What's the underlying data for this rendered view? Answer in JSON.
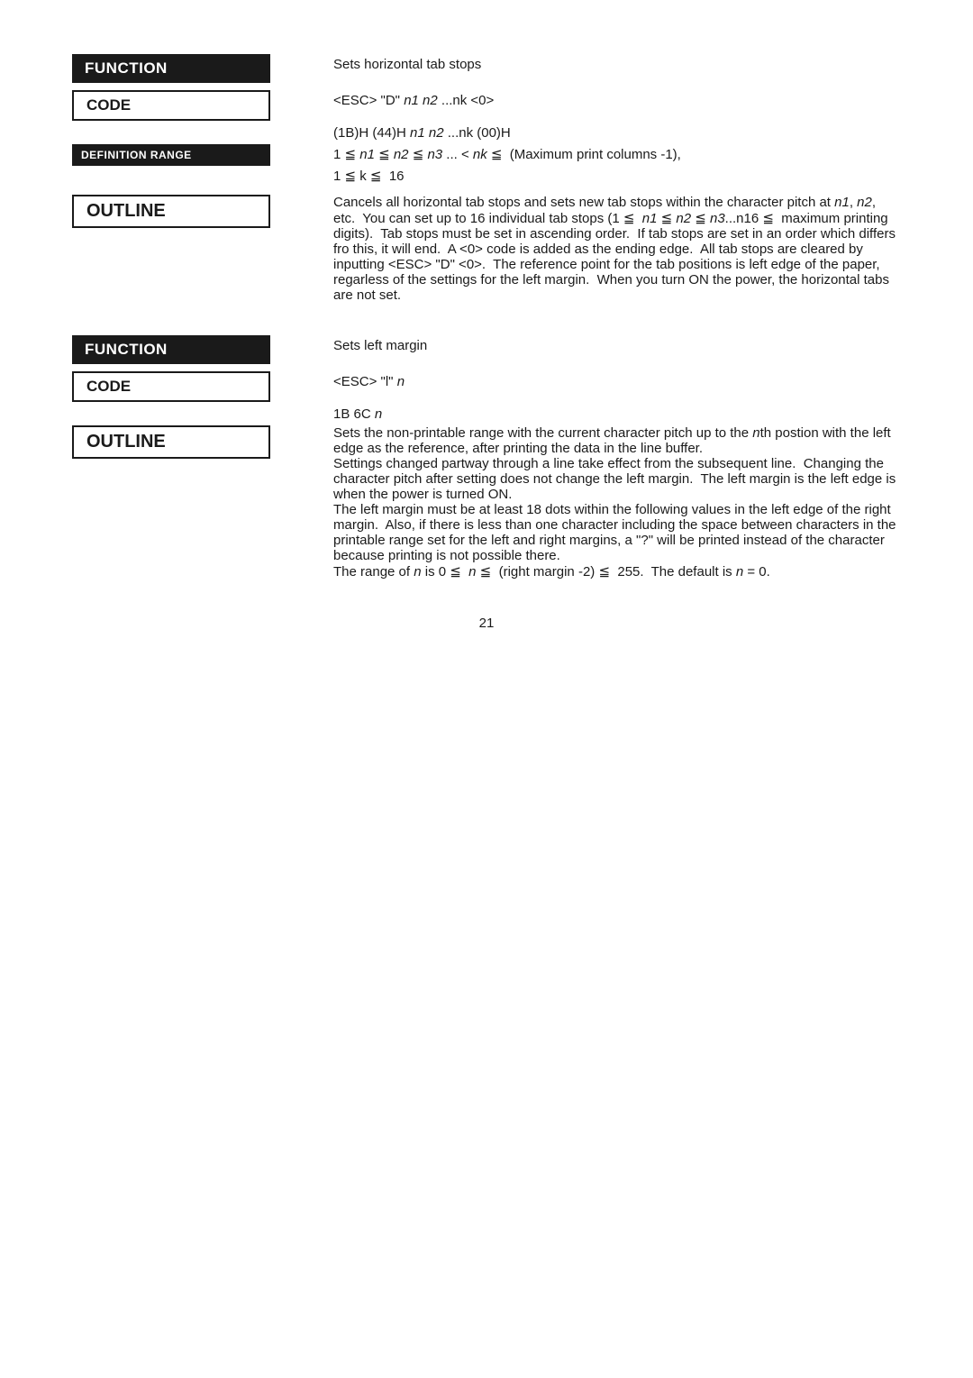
{
  "page": {
    "number": "21",
    "sections": [
      {
        "id": "section1",
        "function_label": "FUNCTION",
        "code_label": "CODE",
        "definition_label": "DEFINITION RANGE",
        "outline_label": "OUTLINE",
        "code_text1": "<ESC> \"D\" n1 n2 ...nk <0>",
        "code_text2": "(1B)H (44)H n1 n2 ...nk (00)H",
        "function_desc": "Sets horizontal tab stops",
        "definition_range_text": "1 ≦ n1 ≦ n2 ≦ n3 ... < nk ≦  (Maximum print columns -1),",
        "definition_range_text2": "1 ≦ k ≦  16",
        "outline_paragraphs": [
          "Cancels all horizontal tab stops and sets new tab stops within the character pitch at n1, n2, etc.  You can set up to 16 individual tab stops (1 ≦  n1 ≦ n2 ≦ n3...n16 ≦  maximum printing digits).  Tab stops must be set in ascending order.  If tab stops are set in an order which differs fro this, it will end.  A <0> code is added as the ending edge.  All tab stops are cleared by inputting <ESC> \"D\" <0>.  The reference point for the tab positions is left edge of the paper, regarless of the settings for the left margin.  When you turn ON the power, the horizontal tabs are not set."
        ]
      },
      {
        "id": "section2",
        "function_label": "FUNCTION",
        "code_label": "CODE",
        "outline_label": "OUTLINE",
        "function_desc": "Sets left margin",
        "code_text1": "<ESC> \"l\" n",
        "code_text2": "1B 6C n",
        "outline_paragraphs": [
          "Sets the non-printable range with the current character pitch up to the nth postion with the left edge as the reference, after printing the data in the line buffer.",
          "Settings changed partway through a line take effect from the subsequent line.  Changing the character pitch after setting does not change the left margin.  The left margin is the left edge is when the power is turned ON.",
          "The left margin must be at least 18 dots within the following values in the left edge of the right margin.  Also, if there is less than one character including the space between characters in the printable range set for the left and right margins, a \"?\" will be printed instead of the character because printing is not possible there.",
          "The range of n is 0 ≦  n ≦  (right margin -2) ≦  255.  The default is n = 0."
        ]
      }
    ]
  }
}
